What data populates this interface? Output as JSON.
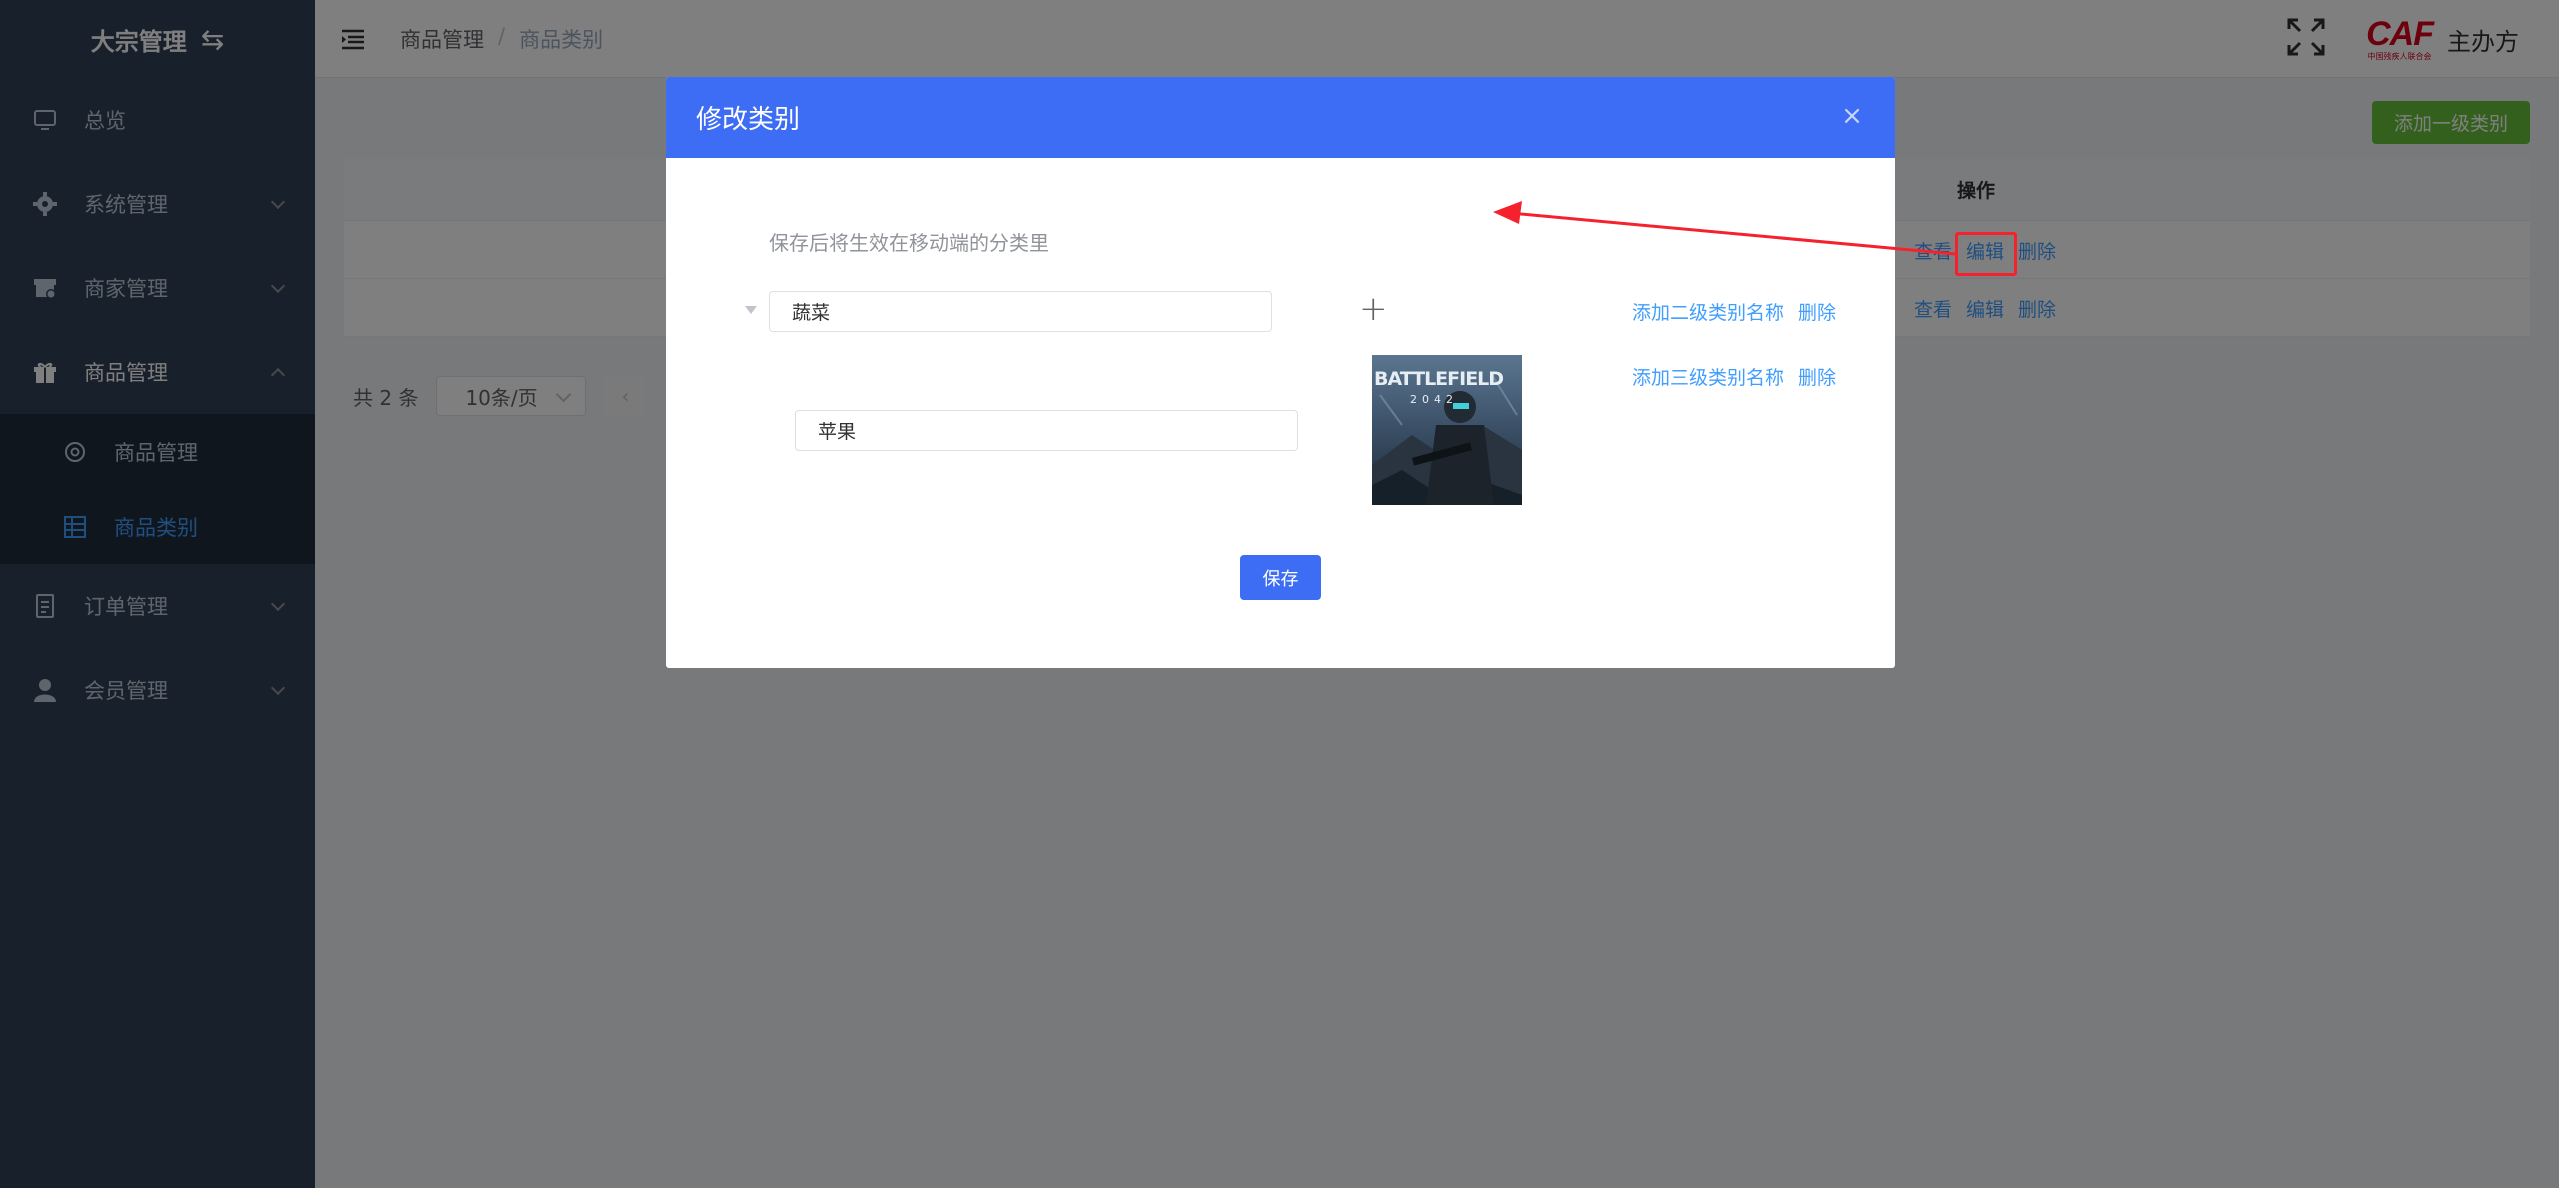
{
  "sidebar": {
    "title": "大宗管理",
    "items": [
      {
        "label": "总览",
        "icon": "monitor-icon"
      },
      {
        "label": "系统管理",
        "icon": "gear-icon"
      },
      {
        "label": "商家管理",
        "icon": "store-icon"
      },
      {
        "label": "商品管理",
        "icon": "gift-icon"
      },
      {
        "label": "订单管理",
        "icon": "document-icon"
      },
      {
        "label": "会员管理",
        "icon": "user-icon"
      }
    ],
    "submenu": [
      {
        "label": "商品管理",
        "icon": "gear-outline-icon"
      },
      {
        "label": "商品类别",
        "icon": "grid-icon",
        "active": true
      }
    ],
    "active_color": "#409eff"
  },
  "header": {
    "breadcrumb": [
      "商品管理",
      "/",
      "商品类别"
    ],
    "org_logo": "CAF",
    "org_logo_subtext": "中国残疾人联合会",
    "org_name": "主办方"
  },
  "main": {
    "add_button": "添加一级类别",
    "table": {
      "op_header": "操作",
      "rows": [
        {
          "ops": [
            "查看",
            "编辑",
            "删除"
          ]
        },
        {
          "ops": [
            "查看",
            "编辑",
            "删除"
          ]
        }
      ]
    },
    "pager": {
      "total": "共 2 条",
      "page_size": "10条/页"
    }
  },
  "dialog": {
    "title": "修改类别",
    "hint": "保存后将生效在移动端的分类里",
    "level1_value": "蔬菜",
    "level2_value": "苹果",
    "add_level2_label": "添加二级类别名称",
    "add_level3_label": "添加三级类别名称",
    "delete_label": "删除",
    "thumbnail_text": "BATTLEFIELD",
    "thumbnail_subtext": "2042",
    "save_label": "保存"
  },
  "colors": {
    "sidebar_bg": "#304156",
    "dialog_header": "#3d6cf5",
    "add_button": "#67c23a",
    "link": "#409eff",
    "annotation_red": "#f5222d"
  }
}
